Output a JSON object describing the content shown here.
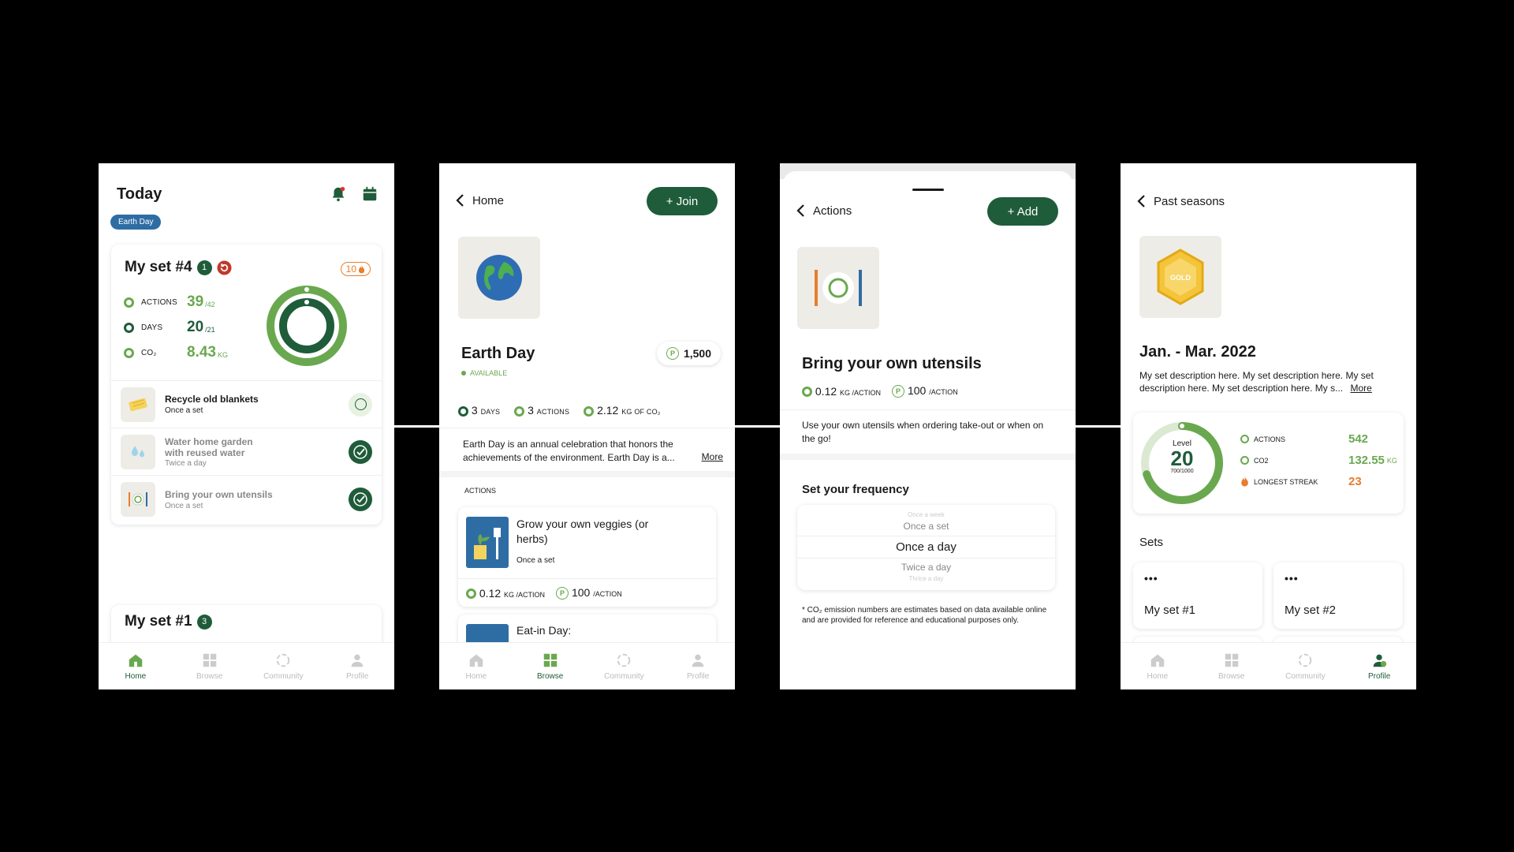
{
  "screen1": {
    "title": "Today",
    "badge": "Earth Day",
    "set_title": "My set #4",
    "set_count": "1",
    "streak": "10",
    "stats": [
      {
        "label": "ACTIONS",
        "value": "39",
        "unit": "/42"
      },
      {
        "label": "DAYS",
        "value": "20",
        "unit": "/21"
      },
      {
        "label": "CO₂",
        "value": "8.43",
        "unit": "KG"
      }
    ],
    "actions": [
      {
        "title": "Recycle old blankets",
        "freq": "Once a set",
        "done": false
      },
      {
        "title": "Water home garden with reused water",
        "freq": "Twice a day",
        "done": true
      },
      {
        "title": "Bring your own utensils",
        "freq": "Once a set",
        "done": true
      }
    ],
    "next_set_title": "My set #1",
    "next_set_count": "3",
    "active_tab": "Home"
  },
  "screen2": {
    "back_label": "Home",
    "join_label": "+ Join",
    "title": "Earth Day",
    "status": "AVAILABLE",
    "points": "1,500",
    "stats": [
      {
        "value": "3",
        "unit": "DAYS"
      },
      {
        "value": "3",
        "unit": "ACTIONS"
      },
      {
        "value": "2.12",
        "unit": "KG OF CO₂"
      }
    ],
    "description": "Earth Day is an annual celebration that honors the achievements of the environment. Earth Day is a...",
    "more_label": "More",
    "section_label": "ACTIONS",
    "action1_title": "Grow your own veggies (or herbs)",
    "action1_freq": "Once a set",
    "action1_co2": "0.12",
    "action1_co2_unit": "KG /ACTION",
    "action1_points": "100",
    "action1_points_unit": "/ACTION",
    "action2_title": "Eat-in Day:",
    "active_tab": "Browse"
  },
  "screen3": {
    "back_label": "Actions",
    "add_label": "+ Add",
    "title": "Bring your own utensils",
    "co2": "0.12",
    "co2_unit": "KG /ACTION",
    "points": "100",
    "points_unit": "/ACTION",
    "description": "Use your own utensils when ordering take-out or when on the go!",
    "freq_heading": "Set your frequency",
    "picker": [
      "Once a week",
      "Once a set",
      "Once a day",
      "Twice a day",
      "Thrice a day"
    ],
    "footnote": "* CO₂ emission numbers are estimates based on data available online and are provided for reference and educational purposes only."
  },
  "screen4": {
    "back_label": "Past seasons",
    "medal_text": "GOLD",
    "title": "Jan. - Mar. 2022",
    "description": "My set description here. My set description here. My set description here. My set description here. My s...",
    "more_label": "More",
    "level_label": "Level",
    "level_value": "20",
    "level_progress": "700/1000",
    "level_fraction": 0.7,
    "stats": [
      {
        "label": "ACTIONS",
        "value": "542",
        "unit": ""
      },
      {
        "label": "CO2",
        "value": "132.55",
        "unit": "KG"
      },
      {
        "label": "LONGEST STREAK",
        "value": "23",
        "unit": ""
      }
    ],
    "sets_heading": "Sets",
    "sets": [
      {
        "label": "My set #1",
        "more": "•••"
      },
      {
        "label": "My set #2",
        "more": "•••"
      }
    ],
    "active_tab": "Profile"
  },
  "tabs": [
    "Home",
    "Browse",
    "Community",
    "Profile"
  ],
  "colors": {
    "dark_green": "#1f5c3a",
    "light_green": "#6aa84f",
    "orange": "#e87d2f",
    "badge_blue": "#2e6da4"
  }
}
